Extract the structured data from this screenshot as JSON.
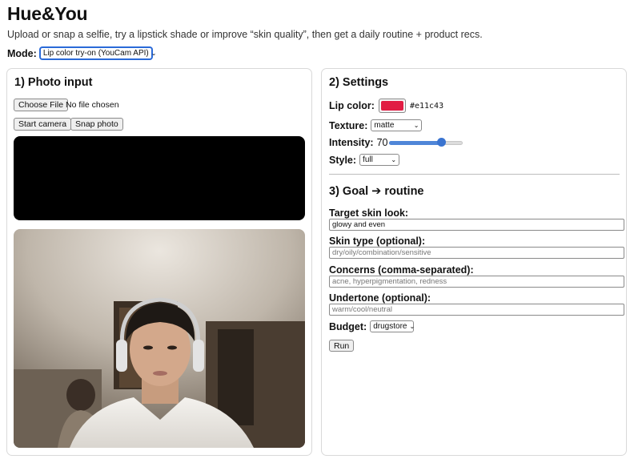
{
  "app": {
    "title": "Hue&You",
    "subtitle": "Upload or snap a selfie, try a lipstick shade or improve “skin quality”, then get a daily routine + product recs."
  },
  "mode": {
    "label": "Mode:",
    "selected": "Lip color try-on (YouCam API)"
  },
  "photo_input": {
    "heading": "1) Photo input",
    "choose_file_label": "Choose File",
    "no_file_text": "No file chosen",
    "start_camera_label": "Start camera",
    "snap_photo_label": "Snap photo"
  },
  "settings": {
    "heading": "2) Settings",
    "lip_color_label": "Lip color:",
    "lip_color_value": "#e11c43",
    "texture_label": "Texture:",
    "texture_selected": "matte",
    "intensity_label": "Intensity:",
    "intensity_value": "70",
    "intensity_fraction": 0.7,
    "style_label": "Style:",
    "style_selected": "full"
  },
  "routine": {
    "heading": "3) Goal ➔ routine",
    "target_label": "Target skin look:",
    "target_value": "glowy and even",
    "skin_type_label": "Skin type (optional):",
    "skin_type_placeholder": "dry/oily/combination/sensitive",
    "concerns_label": "Concerns (comma-separated):",
    "concerns_placeholder": "acne, hyperpigmentation, redness",
    "undertone_label": "Undertone (optional):",
    "undertone_placeholder": "warm/cool/neutral",
    "budget_label": "Budget:",
    "budget_selected": "drugstore",
    "run_label": "Run"
  }
}
